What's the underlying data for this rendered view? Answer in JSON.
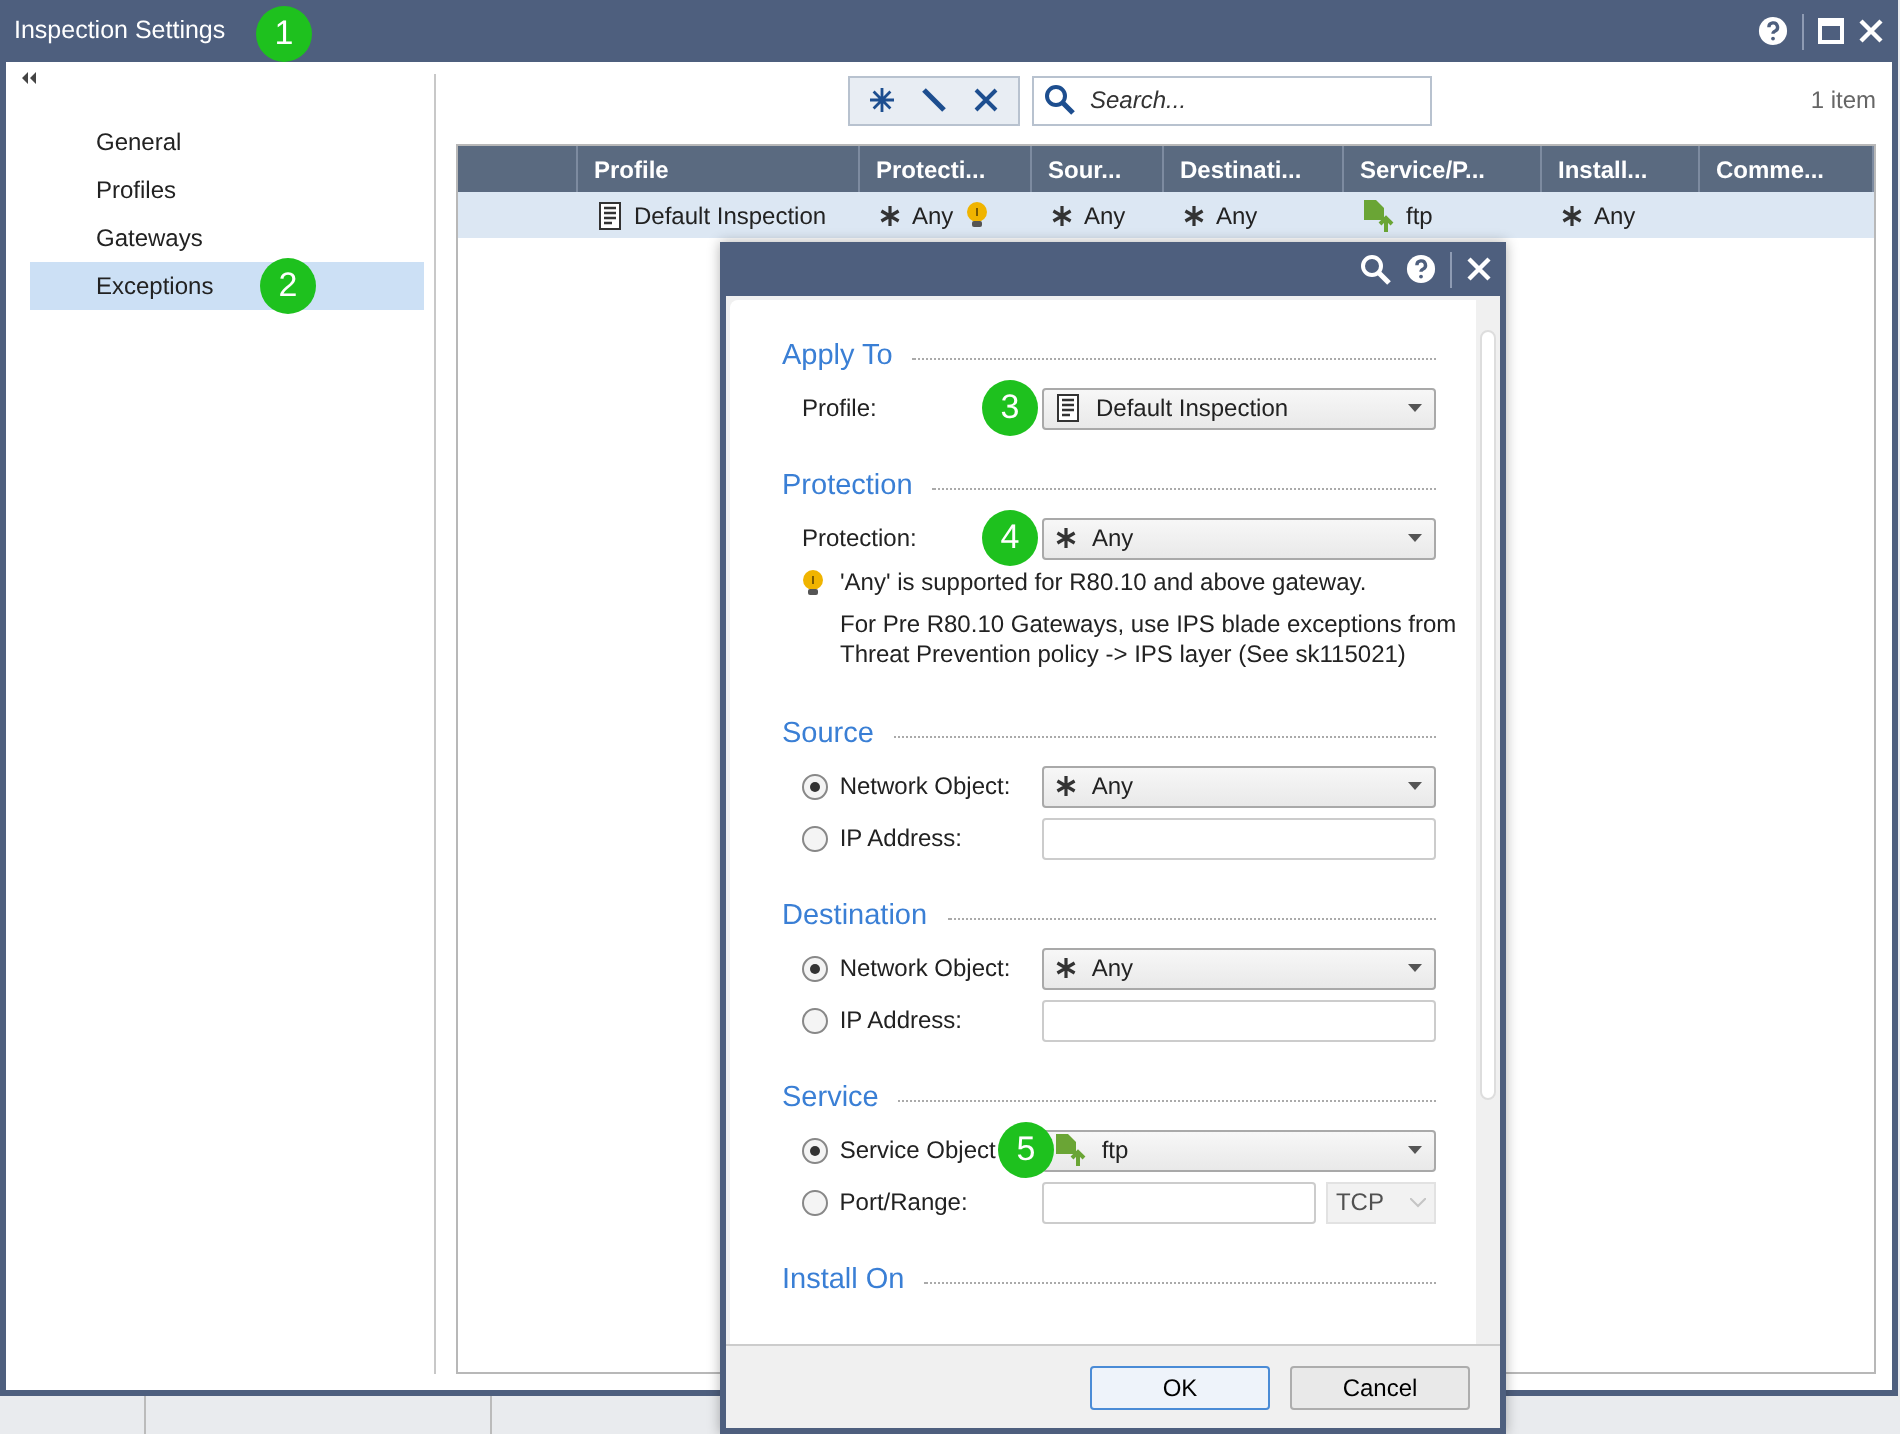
{
  "window": {
    "title": "Inspection Settings",
    "callout": "1"
  },
  "sidebar": {
    "items": [
      {
        "label": "General",
        "selected": false
      },
      {
        "label": "Profiles",
        "selected": false
      },
      {
        "label": "Gateways",
        "selected": false
      },
      {
        "label": "Exceptions",
        "selected": true,
        "callout": "2"
      }
    ]
  },
  "toolbar": {
    "search": {
      "placeholder": "Search..."
    },
    "item_count": "1 item"
  },
  "table": {
    "columns": [
      "",
      "Profile",
      "Protecti...",
      "Sour...",
      "Destinati...",
      "Service/P...",
      "Install...",
      "Comme..."
    ],
    "rows": [
      {
        "selected": true,
        "cells": [
          {
            "text": ""
          },
          {
            "text": "Default Inspection",
            "kind": "profile"
          },
          {
            "text": "Any",
            "kind": "any",
            "note": true
          },
          {
            "text": "Any",
            "kind": "any"
          },
          {
            "text": "Any",
            "kind": "any"
          },
          {
            "text": "ftp",
            "kind": "service"
          },
          {
            "text": "Any",
            "kind": "any"
          },
          {
            "text": ""
          }
        ]
      }
    ]
  },
  "dialog": {
    "sections": [
      {
        "title": "Apply To",
        "rows": [
          {
            "kind": "select",
            "label": "Profile:",
            "value": {
              "text": "Default Inspection",
              "kind": "profile"
            },
            "callout": "3"
          }
        ]
      },
      {
        "title": "Protection",
        "rows": [
          {
            "kind": "select",
            "label": "Protection:",
            "value": {
              "text": "Any",
              "kind": "any"
            },
            "callout": "4"
          },
          {
            "kind": "note",
            "lines": [
              "'Any' is supported for R80.10 and above gateway.",
              "For Pre R80.10 Gateways, use IPS blade exceptions from Threat Prevention policy -> IPS layer (See sk115021)"
            ]
          }
        ]
      },
      {
        "title": "Source",
        "rows": [
          {
            "kind": "radio-select",
            "label": "Network Object:",
            "selected": true,
            "value": {
              "text": "Any",
              "kind": "any"
            }
          },
          {
            "kind": "radio-input",
            "label": "IP Address:",
            "selected": false
          }
        ]
      },
      {
        "title": "Destination",
        "rows": [
          {
            "kind": "radio-select",
            "label": "Network Object:",
            "selected": true,
            "value": {
              "text": "Any",
              "kind": "any"
            }
          },
          {
            "kind": "radio-input",
            "label": "IP Address:",
            "selected": false
          }
        ]
      },
      {
        "title": "Service",
        "rows": [
          {
            "kind": "radio-select",
            "label": "Service Object",
            "selected": true,
            "value": {
              "text": "ftp",
              "kind": "service"
            },
            "callout": "5"
          },
          {
            "kind": "radio-port",
            "label": "Port/Range:",
            "selected": false,
            "protocol": "TCP",
            "protocol_disabled": true
          }
        ]
      },
      {
        "title": "Install On"
      }
    ],
    "buttons": [
      {
        "label": "OK",
        "default": true
      },
      {
        "label": "Cancel",
        "default": false
      }
    ]
  }
}
